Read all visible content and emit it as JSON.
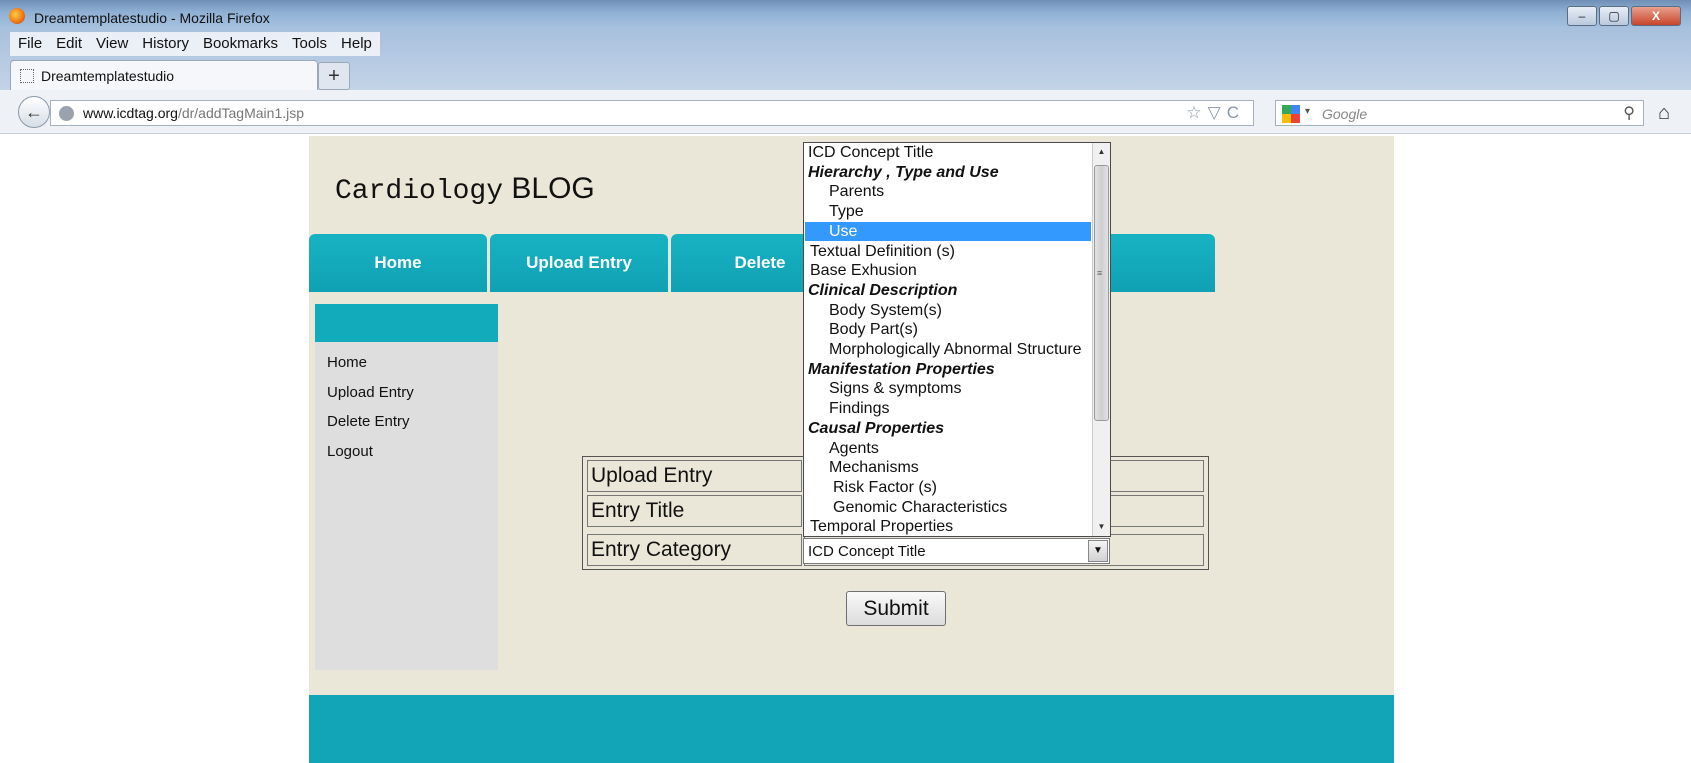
{
  "window": {
    "title": "Dreamtemplatestudio - Mozilla Firefox",
    "controls": [
      "–",
      "▢",
      "X"
    ]
  },
  "menu": [
    "File",
    "Edit",
    "View",
    "History",
    "Bookmarks",
    "Tools",
    "Help"
  ],
  "tab": {
    "label": "Dreamtemplatestudio",
    "new_tab": "+"
  },
  "address": {
    "url_domain": "www.icdtag.org",
    "url_path": "/dr/addTagMain1.jsp",
    "icons": "☆▽C"
  },
  "search": {
    "placeholder": "Google",
    "caret": "▾",
    "icon": "⚲"
  },
  "nav_buttons": {
    "back": "←",
    "home": "⌂"
  },
  "blog": {
    "title_mono": "Cardiology",
    "title_sans": "BLOG"
  },
  "nav_tabs": [
    "Home",
    "Upload Entry",
    "Delete",
    "",
    ""
  ],
  "sidebar": {
    "items": [
      "Home",
      "Upload Entry",
      "Delete Entry",
      "Logout"
    ]
  },
  "form": {
    "rows": [
      "Upload Entry",
      "Entry Title",
      "Entry Category"
    ],
    "category_value": "ICD Concept Title",
    "dropdown_arrow": "▼",
    "submit_label": "Submit"
  },
  "dropdown": {
    "options": [
      {
        "label": "ICD Concept Title",
        "type": "option",
        "indent": 3
      },
      {
        "label": "Hierarchy , Type and Use",
        "type": "group",
        "indent": 3
      },
      {
        "label": "Parents",
        "type": "option",
        "indent": 24
      },
      {
        "label": "Type",
        "type": "option",
        "indent": 24
      },
      {
        "label": "Use",
        "type": "option",
        "indent": 24,
        "selected": true
      },
      {
        "label": "Textual Definition (s)",
        "type": "option",
        "indent": 5
      },
      {
        "label": "Base Exhusion",
        "type": "option",
        "indent": 5
      },
      {
        "label": "Clinical Description",
        "type": "group",
        "indent": 3
      },
      {
        "label": "Body System(s)",
        "type": "option",
        "indent": 24
      },
      {
        "label": "Body Part(s)",
        "type": "option",
        "indent": 24
      },
      {
        "label": "Morphologically Abnormal Structure",
        "type": "option",
        "indent": 24
      },
      {
        "label": "Manifestation Properties",
        "type": "group",
        "indent": 3
      },
      {
        "label": "Signs & symptoms",
        "type": "option",
        "indent": 24
      },
      {
        "label": "Findings",
        "type": "option",
        "indent": 24
      },
      {
        "label": "Causal Properties",
        "type": "group",
        "indent": 3
      },
      {
        "label": "Agents",
        "type": "option",
        "indent": 24
      },
      {
        "label": "Mechanisms",
        "type": "option",
        "indent": 24
      },
      {
        "label": "Risk Factor (s)",
        "type": "option",
        "indent": 28
      },
      {
        "label": "Genomic Characteristics",
        "type": "option",
        "indent": 28
      },
      {
        "label": "Temporal Properties",
        "type": "option",
        "indent": 5
      }
    ],
    "scroll_up": "▲",
    "scroll_down": "▼",
    "grip": "≡"
  },
  "colors": {
    "teal": "#11a5b7",
    "page_bg": "#ebe7d8",
    "sidebar_bg": "#dedede",
    "selection": "#3399ff"
  }
}
